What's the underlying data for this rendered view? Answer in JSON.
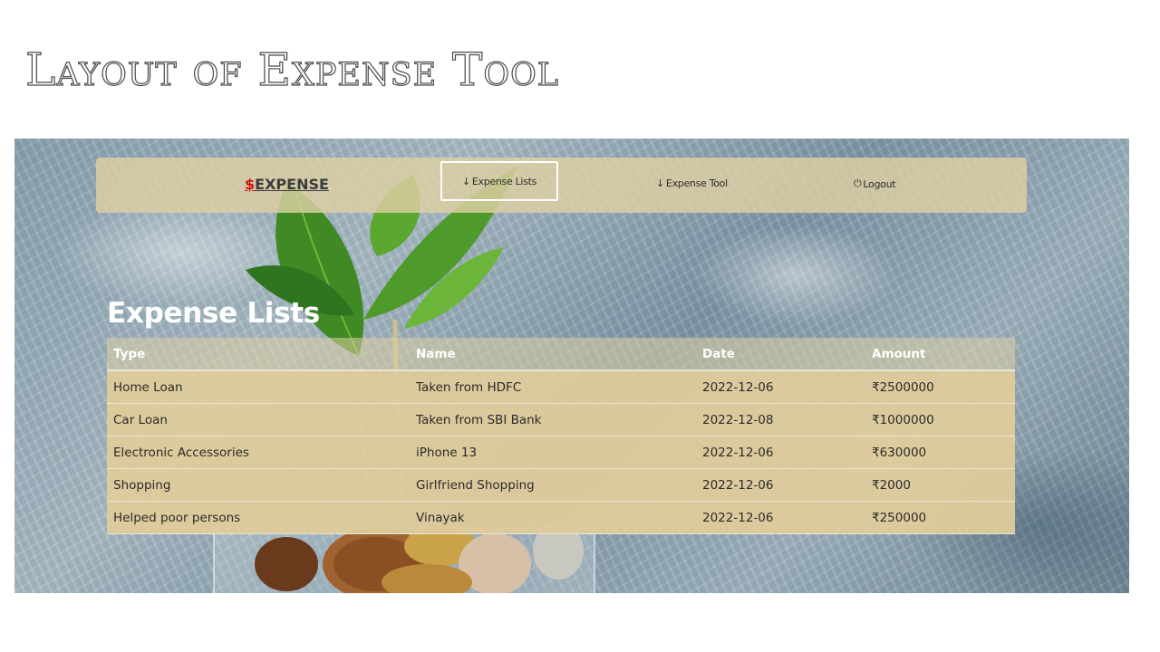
{
  "slide": {
    "title": "Layout of Expense Tool"
  },
  "navbar": {
    "brand_symbol": "$",
    "brand_text": "EXPENSE",
    "links": [
      {
        "label": "Expense Lists",
        "icon": "arrow-down-icon",
        "active": true
      },
      {
        "label": "Expense Tool",
        "icon": "arrow-down-icon",
        "active": false
      },
      {
        "label": "Logout",
        "icon": "power-icon",
        "active": false
      }
    ]
  },
  "page": {
    "heading": "Expense Lists"
  },
  "table": {
    "headers": [
      "Type",
      "Name",
      "Date",
      "Amount"
    ],
    "rows": [
      [
        "Home Loan",
        "Taken from HDFC",
        "2022-12-06",
        "₹2500000"
      ],
      [
        "Car Loan",
        "Taken from SBI Bank",
        "2022-12-08",
        "₹1000000"
      ],
      [
        "Electronic Accessories",
        "iPhone 13",
        "2022-12-06",
        "₹630000"
      ],
      [
        "Shopping",
        "Girlfriend Shopping",
        "2022-12-06",
        "₹2000"
      ],
      [
        "Helped poor persons",
        "Vinayak",
        "2022-12-06",
        "₹250000"
      ]
    ]
  },
  "colors": {
    "brand_dollar": "#d01010",
    "navbar_bg": "#decfa3",
    "row_bg": "#decb9b"
  }
}
